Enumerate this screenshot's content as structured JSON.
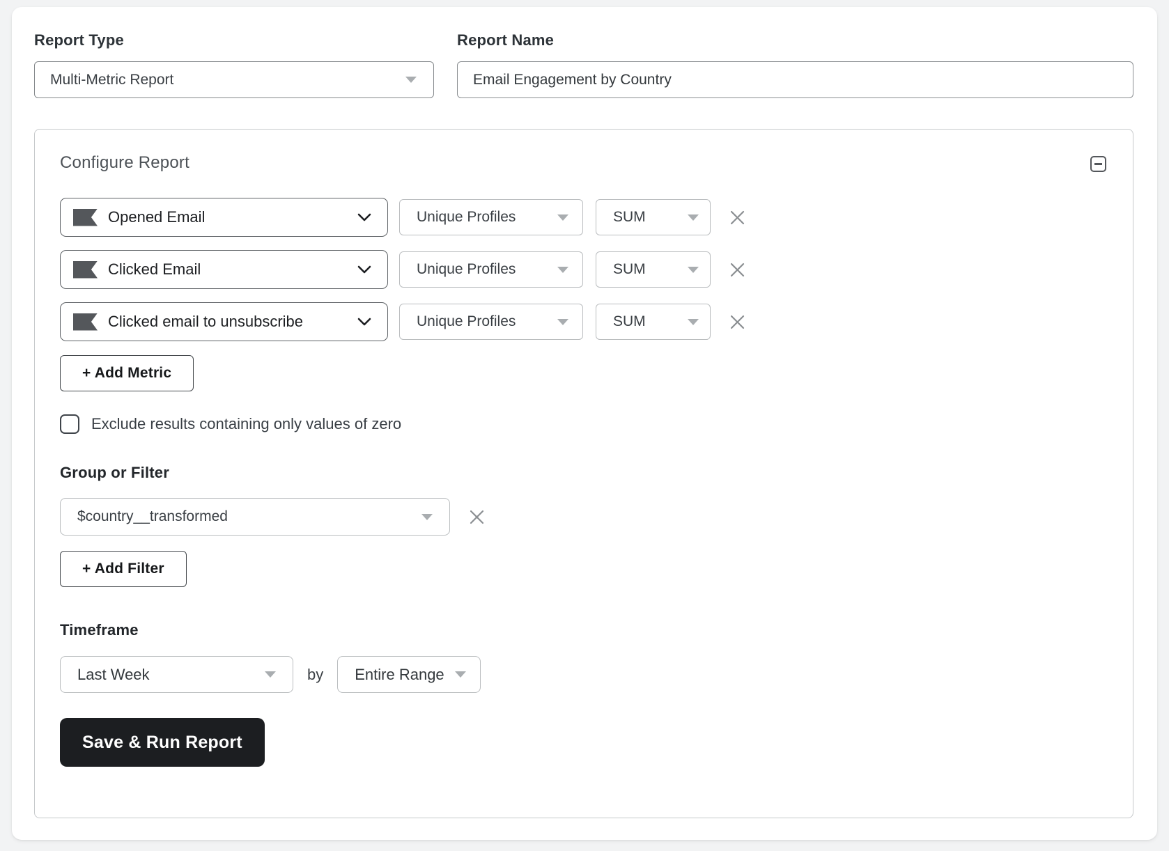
{
  "report_type": {
    "label": "Report Type",
    "value": "Multi-Metric Report"
  },
  "report_name": {
    "label": "Report Name",
    "value": "Email Engagement by Country"
  },
  "configure": {
    "title": "Configure Report",
    "metrics": [
      {
        "name": "Opened Email",
        "measurement": "Unique Profiles",
        "aggregate": "SUM"
      },
      {
        "name": "Clicked Email",
        "measurement": "Unique Profiles",
        "aggregate": "SUM"
      },
      {
        "name": "Clicked email to unsubscribe",
        "measurement": "Unique Profiles",
        "aggregate": "SUM"
      }
    ],
    "add_metric_label": "+ Add Metric",
    "exclude_zero": {
      "label": "Exclude results containing only values of zero",
      "checked": false
    },
    "group_or_filter": {
      "label": "Group or Filter",
      "value": "$country__transformed",
      "add_filter_label": "+ Add Filter"
    },
    "timeframe": {
      "label": "Timeframe",
      "range_value": "Last Week",
      "by_label": "by",
      "granularity_value": "Entire Range"
    },
    "save_button_label": "Save & Run Report"
  },
  "icons": {
    "metric_flag": "flag",
    "metric_expand": "chevron-down",
    "dropdown_caret": "caret-down-triangle",
    "remove": "close-x",
    "panel_collapse": "minus-square"
  },
  "colors": {
    "primary_button_bg": "#1c1e21",
    "primary_button_text": "#ffffff",
    "dark_border": "#5d6165",
    "light_border": "#babdbf",
    "panel_border": "#c6c9cb",
    "caret_gray": "#a9adb0",
    "icon_gray": "#8a8e91",
    "flag_icon": "#54575b",
    "label_text": "#2d3338",
    "body_text": "#3a3f44"
  }
}
